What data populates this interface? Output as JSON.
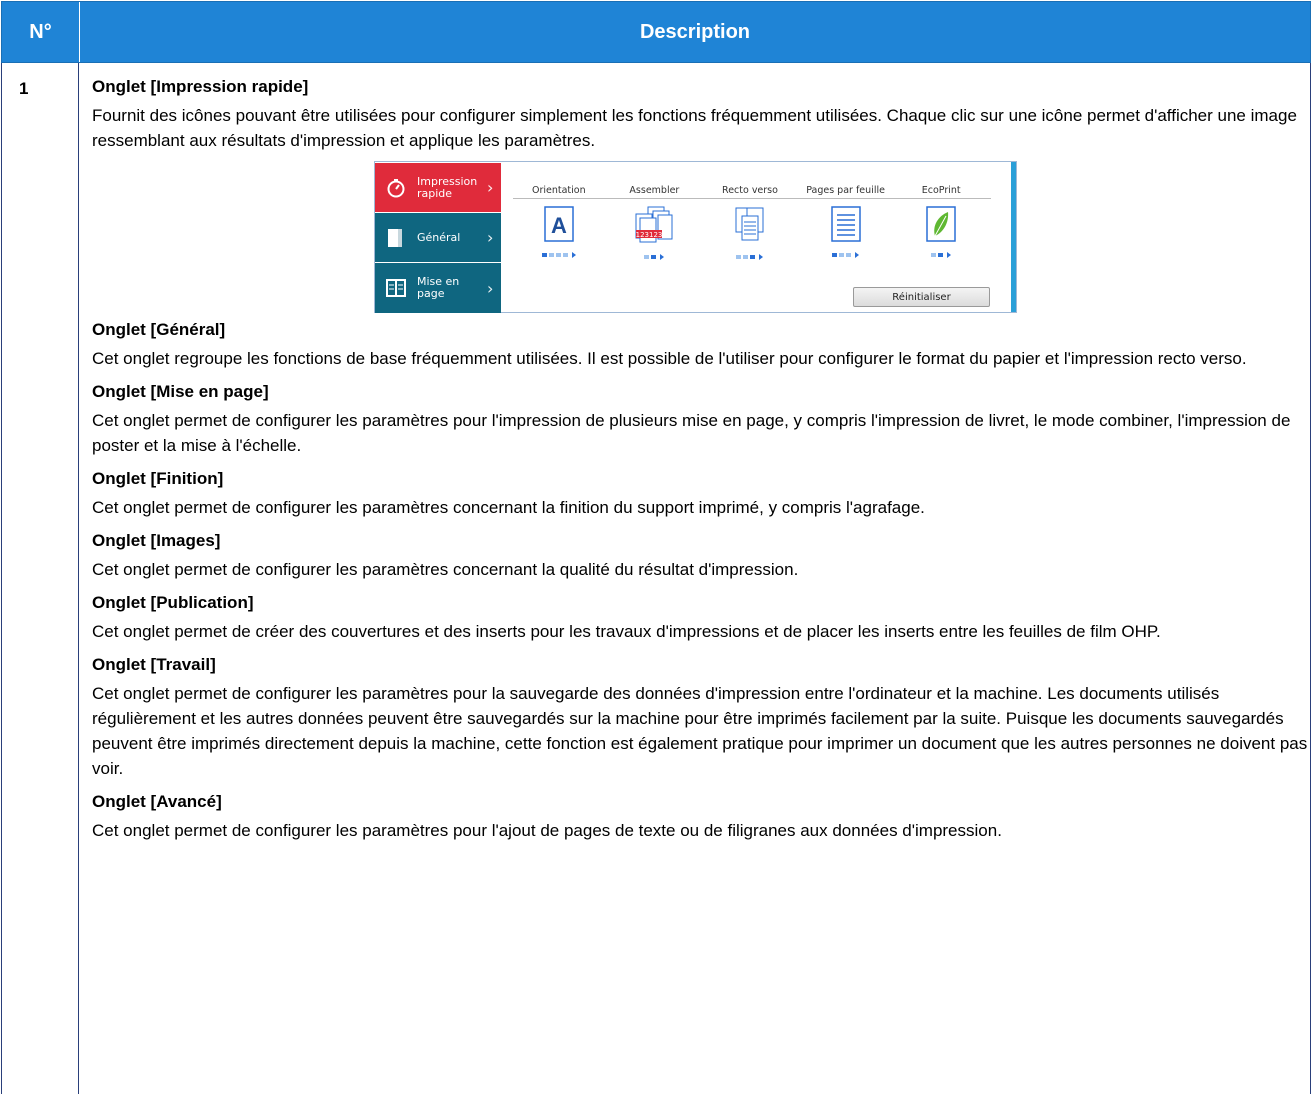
{
  "header": {
    "col_num": "N°",
    "col_desc": "Description"
  },
  "row": {
    "number": "1"
  },
  "sections": [
    {
      "title": "Onglet [Impression rapide]",
      "text": "Fournit des icônes pouvant être utilisées pour configurer simplement les fonctions fréquemment utilisées. Chaque clic sur une icône permet d'afficher une image ressemblant aux résultats d'impression et applique les paramètres."
    },
    {
      "title": "Onglet [Général]",
      "text": "Cet onglet regroupe les fonctions de base fréquemment utilisées. Il est possible de l'utiliser pour configurer le format du papier et l'impression recto verso."
    },
    {
      "title": "Onglet [Mise en page]",
      "text": "Cet onglet permet de configurer les paramètres pour l'impression de plusieurs mise en page, y compris l'impression de livret, le mode combiner, l'impression de poster et la mise à l'échelle."
    },
    {
      "title": "Onglet [Finition]",
      "text": "Cet onglet permet de configurer les paramètres concernant la finition du support imprimé, y compris l'agrafage."
    },
    {
      "title": "Onglet [Images]",
      "text": "Cet onglet permet de configurer les paramètres concernant la qualité du résultat d'impression."
    },
    {
      "title": "Onglet [Publication]",
      "text": "Cet onglet permet de créer des couvertures et des inserts pour les travaux d'impressions et de placer les inserts entre les feuilles de film OHP."
    },
    {
      "title": "Onglet [Travail]",
      "text": "Cet onglet permet de configurer les paramètres pour la sauvegarde des données d'impression entre l'ordinateur et la machine. Les documents utilisés régulièrement et les autres données peuvent être sauvegardés sur la machine pour être imprimés facilement par la suite. Puisque les documents sauvegardés peuvent être imprimés directement depuis la machine, cette fonction est également pratique pour imprimer un document que les autres personnes ne doivent pas voir."
    },
    {
      "title": "Onglet [Avancé]",
      "text": "Cet onglet permet de configurer les paramètres pour l'ajout de pages de texte ou de filigranes aux données d'impression."
    }
  ],
  "screenshot": {
    "tabs": [
      {
        "label": "Impression rapide",
        "icon": "stopwatch-icon"
      },
      {
        "label": "Général",
        "icon": "page-icon"
      },
      {
        "label": "Mise en page",
        "icon": "layout-icon"
      }
    ],
    "columns": [
      "Orientation",
      "Assembler",
      "Recto verso",
      "Pages par feuille",
      "EcoPrint"
    ],
    "orientation_glyph": "A",
    "collate_text": "123123",
    "reset_label": "Réinitialiser",
    "colors": {
      "header": "#1f84d6",
      "tab_active": "#e02b3b",
      "tab_inactive": "#0f6680",
      "accent": "#2a6fd6"
    }
  }
}
